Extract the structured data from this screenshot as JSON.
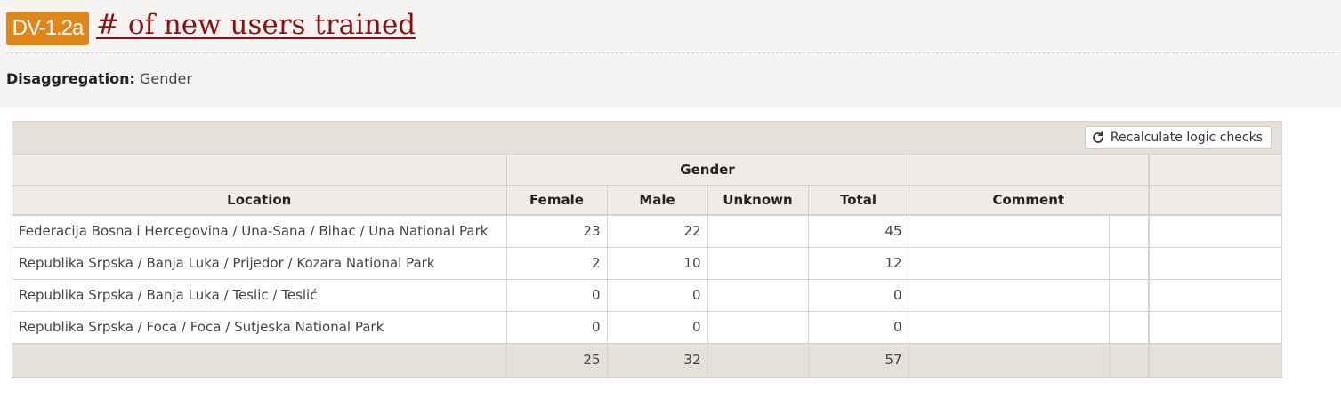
{
  "header": {
    "badge": "DV-1.2a",
    "title": "# of new users trained",
    "disaggregation_label": "Disaggregation:",
    "disaggregation_value": "Gender"
  },
  "toolbar": {
    "recalc_label": "Recalculate logic checks",
    "recalc_icon": "refresh-icon"
  },
  "table": {
    "group_header": "Gender",
    "headers": {
      "location": "Location",
      "female": "Female",
      "male": "Male",
      "unknown": "Unknown",
      "total": "Total",
      "comment": "Comment"
    },
    "rows": [
      {
        "location": "Federacija Bosna i Hercegovina / Una-Sana / Bihac / Una National Park",
        "female": "23",
        "male": "22",
        "unknown": "",
        "total": "45",
        "comment": ""
      },
      {
        "location": "Republika Srpska / Banja Luka / Prijedor / Kozara National Park",
        "female": "2",
        "male": "10",
        "unknown": "",
        "total": "12",
        "comment": ""
      },
      {
        "location": "Republika Srpska / Banja Luka / Teslic / Teslić",
        "female": "0",
        "male": "0",
        "unknown": "",
        "total": "0",
        "comment": ""
      },
      {
        "location": "Republika Srpska / Foca / Foca / Sutjeska National Park",
        "female": "0",
        "male": "0",
        "unknown": "",
        "total": "0",
        "comment": ""
      }
    ],
    "totals": {
      "female": "25",
      "male": "32",
      "unknown": "",
      "total": "57"
    }
  },
  "colors": {
    "badge": "#e0861a",
    "title": "#8b1010",
    "header_bg": "#f5f4f2",
    "grid_band": "#e5e0d9"
  }
}
